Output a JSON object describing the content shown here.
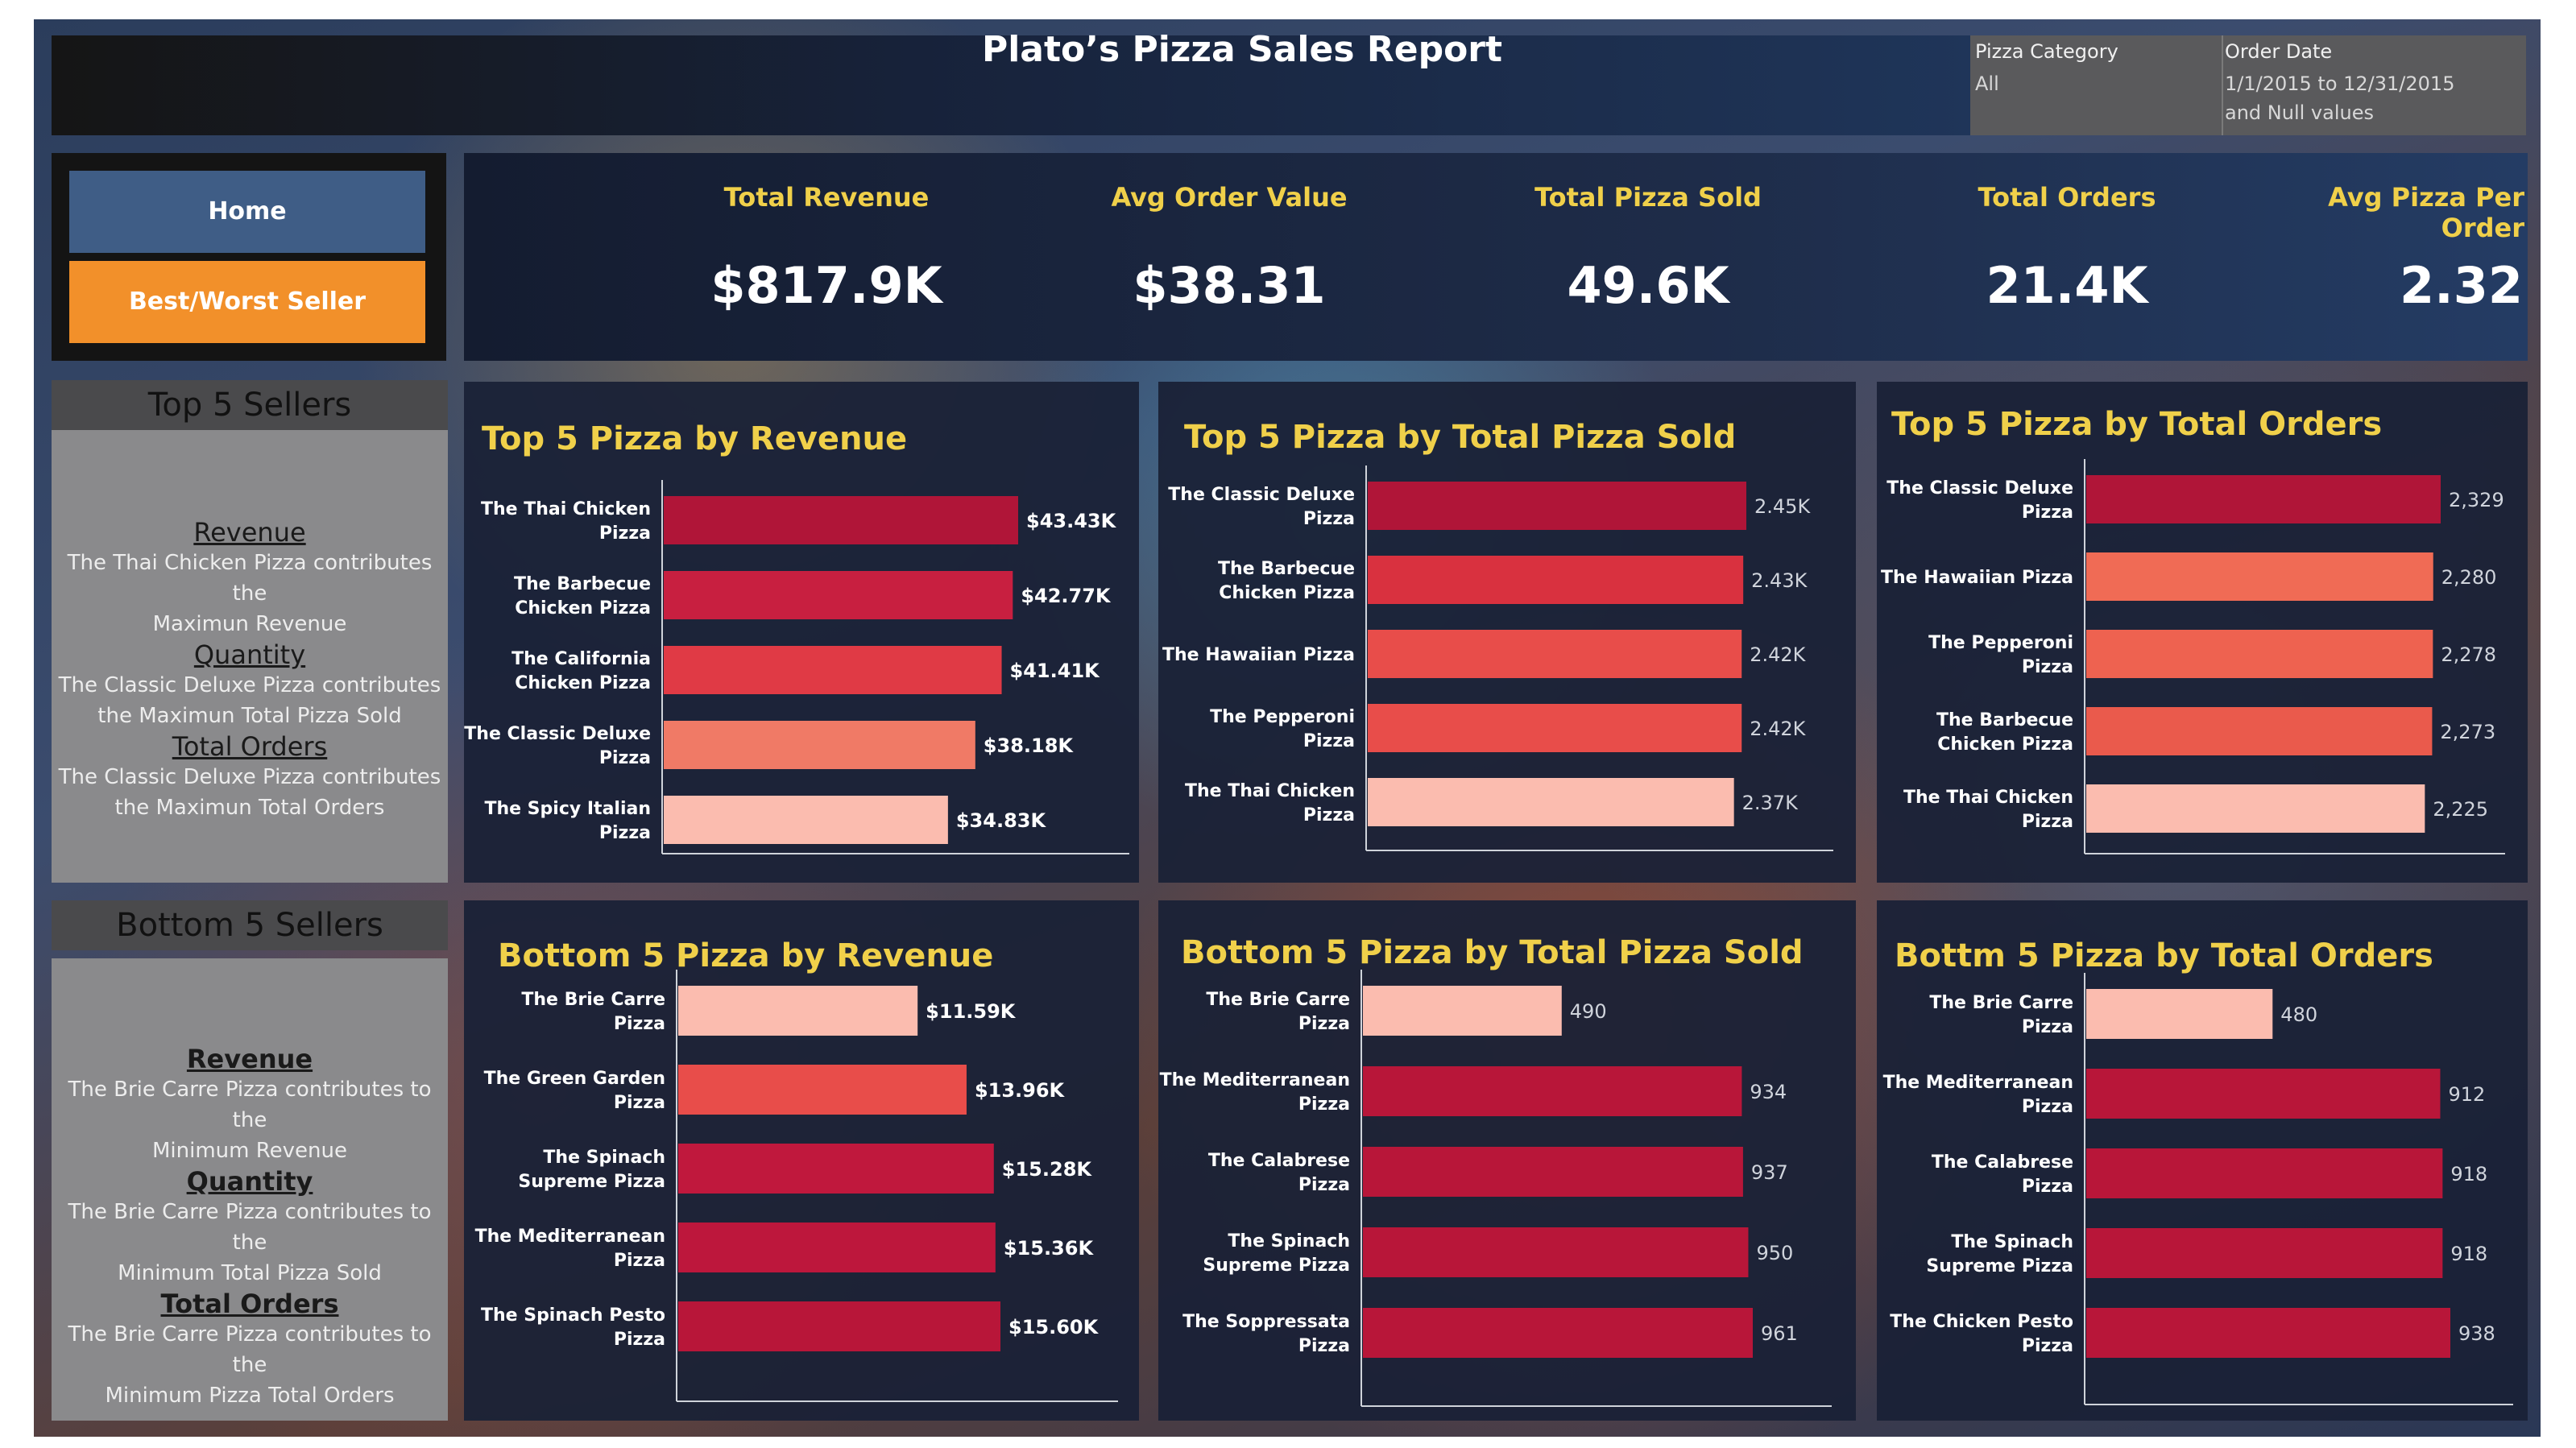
{
  "header": {
    "title": "Plato’s Pizza Sales Report",
    "filters": {
      "category_label": "Pizza Category",
      "category_value": "All",
      "date_label": "Order Date",
      "date_value_line1": "1/1/2015 to 12/31/2015",
      "date_value_line2": "and Null values"
    }
  },
  "nav": {
    "home_label": "Home",
    "bestworst_label": "Best/Worst Seller"
  },
  "kpis": [
    {
      "label": "Total Revenue",
      "value": "$817.9K"
    },
    {
      "label": "Avg Order Value",
      "value": "$38.31"
    },
    {
      "label": "Total Pizza Sold",
      "value": "49.6K"
    },
    {
      "label": "Total Orders",
      "value": "21.4K"
    },
    {
      "label": "Avg Pizza Per Order",
      "value": "2.32"
    }
  ],
  "top_sellers": {
    "title": "Top 5 Sellers",
    "sections": [
      {
        "heading": "Revenue",
        "text1": "The Thai Chicken Pizza contributes the",
        "text2": "Maximun Revenue"
      },
      {
        "heading": "Quantity",
        "text1": "The Classic Deluxe Pizza contributes",
        "text2": "the Maximun Total Pizza Sold"
      },
      {
        "heading": "Total Orders",
        "text1": "The Classic Deluxe Pizza contributes",
        "text2": "the Maximun Total Orders"
      }
    ]
  },
  "bottom_sellers": {
    "title": "Bottom 5 Sellers",
    "sections": [
      {
        "heading": "Revenue",
        "text1": "The Brie Carre Pizza contributes to the",
        "text2": "Minimum Revenue"
      },
      {
        "heading": "Quantity",
        "text1": "The Brie Carre Pizza contributes to the",
        "text2": "Minimum Total Pizza Sold"
      },
      {
        "heading": "Total Orders",
        "text1": "The Brie Carre Pizza contributes to the",
        "text2": "Minimum Pizza Total Orders"
      }
    ]
  },
  "colors": {
    "title_yellow": "#f0d04a",
    "bar_dark": "#b01538",
    "bar_red": "#cf2a45",
    "bar_mid": "#e84d4a",
    "bar_orange": "#f07a66",
    "bar_light": "#fbbcaf"
  },
  "chart_data": [
    {
      "type": "bar",
      "title": "Top 5 Pizza by Revenue",
      "categories": [
        "The Thai Chicken Pizza",
        "The Barbecue Chicken Pizza",
        "The California Chicken Pizza",
        "The Classic Deluxe Pizza",
        "The Spicy Italian Pizza"
      ],
      "values": [
        43430,
        42770,
        41410,
        38180,
        34830
      ],
      "data_labels": [
        "$43.43K",
        "$42.77K",
        "$41.41K",
        "$38.18K",
        "$34.83K"
      ],
      "colors": [
        "#b01538",
        "#c81f40",
        "#e03a45",
        "#f07a66",
        "#fbbcaf"
      ]
    },
    {
      "type": "bar",
      "title": "Top 5 Pizza by Total Pizza Sold",
      "categories": [
        "The Classic Deluxe Pizza",
        "The Barbecue Chicken Pizza",
        "The Hawaiian Pizza",
        "The Pepperoni Pizza",
        "The Thai Chicken Pizza"
      ],
      "values": [
        2450,
        2430,
        2420,
        2420,
        2370
      ],
      "data_labels": [
        "2.45K",
        "2.43K",
        "2.42K",
        "2.42K",
        "2.37K"
      ],
      "colors": [
        "#b01538",
        "#d9313f",
        "#e84d4a",
        "#e84d4a",
        "#fbbcaf"
      ]
    },
    {
      "type": "bar",
      "title": "Top 5 Pizza by Total Orders",
      "categories": [
        "The Classic Deluxe Pizza",
        "The Hawaiian Pizza",
        "The Pepperoni Pizza",
        "The Barbecue Chicken Pizza",
        "The Thai Chicken Pizza"
      ],
      "values": [
        2329,
        2280,
        2278,
        2273,
        2225
      ],
      "data_labels": [
        "2,329",
        "2,280",
        "2,278",
        "2,273",
        "2,225"
      ],
      "colors": [
        "#b01538",
        "#f06b55",
        "#ee6250",
        "#ea5a4c",
        "#fbbcaf"
      ]
    },
    {
      "type": "bar",
      "title": "Bottom 5 Pizza by Revenue",
      "categories": [
        "The Brie Carre Pizza",
        "The Green Garden Pizza",
        "The Spinach Supreme Pizza",
        "The Mediterranean Pizza",
        "The Spinach Pesto Pizza"
      ],
      "values": [
        11590,
        13960,
        15280,
        15360,
        15600
      ],
      "data_labels": [
        "$11.59K",
        "$13.96K",
        "$15.28K",
        "$15.36K",
        "$15.60K"
      ],
      "colors": [
        "#fbbcaf",
        "#e84d4a",
        "#c0183d",
        "#bd173c",
        "#b81639"
      ]
    },
    {
      "type": "bar",
      "title": "Bottom 5 Pizza by Total Pizza Sold",
      "categories": [
        "The Brie Carre Pizza",
        "The Mediterranean Pizza",
        "The Calabrese Pizza",
        "The Spinach Supreme Pizza",
        "The Soppressata Pizza"
      ],
      "values": [
        490,
        934,
        937,
        950,
        961
      ],
      "data_labels": [
        "490",
        "934",
        "937",
        "950",
        "961"
      ],
      "colors": [
        "#fbbcaf",
        "#b81639",
        "#b81639",
        "#b81639",
        "#b81639"
      ]
    },
    {
      "type": "bar",
      "title": "Bottm 5 Pizza by Total Orders",
      "categories": [
        "The Brie Carre Pizza",
        "The Mediterranean Pizza",
        "The Calabrese Pizza",
        "The Spinach Supreme Pizza",
        "The Chicken Pesto Pizza"
      ],
      "values": [
        480,
        912,
        918,
        918,
        938
      ],
      "data_labels": [
        "480",
        "912",
        "918",
        "918",
        "938"
      ],
      "colors": [
        "#fbbcaf",
        "#b81639",
        "#b81639",
        "#b81639",
        "#b81639"
      ]
    }
  ]
}
